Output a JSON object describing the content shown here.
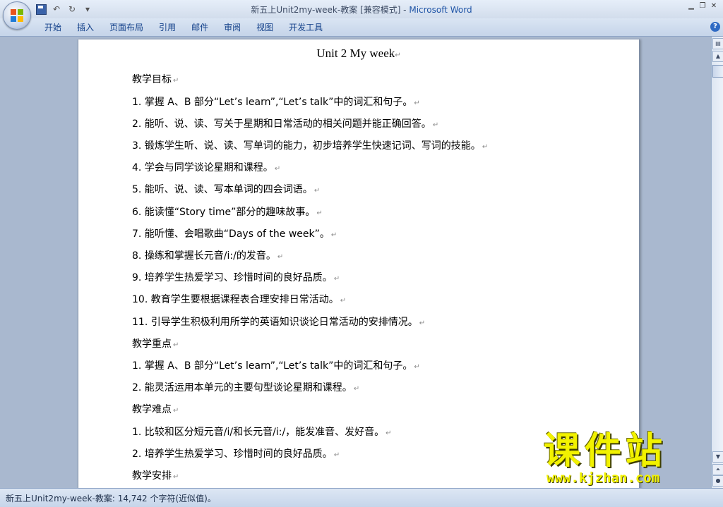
{
  "window": {
    "title": "新五上Unit2my-week-教案 [兼容模式] - ",
    "app_name": "Microsoft Word",
    "controls": [
      "▁",
      "❐",
      "✕"
    ]
  },
  "quick_access": {
    "undo": "↶",
    "redo": "↻",
    "dropdown": "▾"
  },
  "ribbon": {
    "tabs": [
      "开始",
      "插入",
      "页面布局",
      "引用",
      "邮件",
      "审阅",
      "视图",
      "开发工具"
    ],
    "help": "?"
  },
  "document": {
    "title": "Unit 2    My week",
    "paragraph_mark": "↵",
    "paragraphs": [
      "教学目标",
      "1. 掌握 A、B 部分“Let’s learn”,“Let’s talk”中的词汇和句子。",
      "2. 能听、说、读、写关于星期和日常活动的相关问题并能正确回答。",
      "3. 锻炼学生听、说、读、写单词的能力，初步培养学生快速记词、写词的技能。",
      "4. 学会与同学谈论星期和课程。",
      "5. 能听、说、读、写本单词的四会词语。",
      "6. 能读懂“Story time”部分的趣味故事。",
      "7. 能听懂、会唱歌曲“Days of the week”。",
      "8. 操练和掌握长元音/i:/的发音。",
      "9. 培养学生热爱学习、珍惜时间的良好品质。",
      "10. 教育学生要根据课程表合理安排日常活动。",
      "11. 引导学生积极利用所学的英语知识谈论日常活动的安排情况。",
      "教学重点",
      "1. 掌握 A、B 部分“Let’s learn”,“Let’s talk”中的词汇和句子。",
      "2. 能灵活运用本单元的主要句型谈论星期和课程。",
      "教学难点",
      "1. 比较和区分短元音/i/和长元音/i:/，能发准音、发好音。",
      "2. 培养学生热爱学习、珍惜时间的良好品质。",
      "教学安排"
    ]
  },
  "status_bar": {
    "text": "新五上Unit2my-week-教案: 14,742 个字符(近似值)。"
  },
  "watermark": {
    "main": "课件站",
    "url": "www.kjzhan.com"
  },
  "colors": {
    "accent": "#15428b",
    "background": "#a9b8cf",
    "watermark": "#f2f200"
  }
}
